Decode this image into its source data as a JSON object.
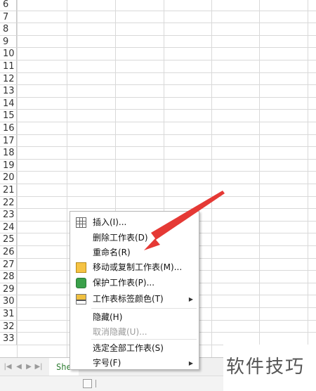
{
  "grid": {
    "row_numbers": [
      "6",
      "7",
      "8",
      "9",
      "10",
      "11",
      "12",
      "13",
      "14",
      "15",
      "16",
      "17",
      "18",
      "19",
      "20",
      "21",
      "22",
      "23",
      "24",
      "25",
      "26",
      "27",
      "28",
      "29",
      "30",
      "31",
      "32",
      "33"
    ]
  },
  "tabbar": {
    "sheet_tab_label": "She"
  },
  "context_menu": {
    "items": [
      {
        "label": "插入(I)...",
        "icon": "insert-table-icon",
        "enabled": true,
        "submenu": false
      },
      {
        "label": "删除工作表(D)",
        "icon": "",
        "enabled": true,
        "submenu": false
      },
      {
        "label": "重命名(R)",
        "icon": "",
        "enabled": true,
        "submenu": false
      },
      {
        "label": "移动或复制工作表(M)...",
        "icon": "move-copy-sheet-icon",
        "enabled": true,
        "submenu": false
      },
      {
        "label": "保护工作表(P)...",
        "icon": "protect-sheet-icon",
        "enabled": true,
        "submenu": false
      },
      {
        "label": "工作表标签颜色(T)",
        "icon": "tab-color-icon",
        "enabled": true,
        "submenu": true
      },
      {
        "label": "隐藏(H)",
        "icon": "",
        "enabled": true,
        "submenu": false
      },
      {
        "label": "取消隐藏(U)...",
        "icon": "",
        "enabled": false,
        "submenu": false
      },
      {
        "label": "选定全部工作表(S)",
        "icon": "",
        "enabled": true,
        "submenu": false
      },
      {
        "label": "字号(F)",
        "icon": "",
        "enabled": true,
        "submenu": true
      }
    ]
  },
  "watermark": {
    "text": "软件技巧"
  },
  "colors": {
    "arrow": "#e53935",
    "sheet_tab_text": "#2e7d32",
    "grid_line": "#d9d9d9"
  }
}
